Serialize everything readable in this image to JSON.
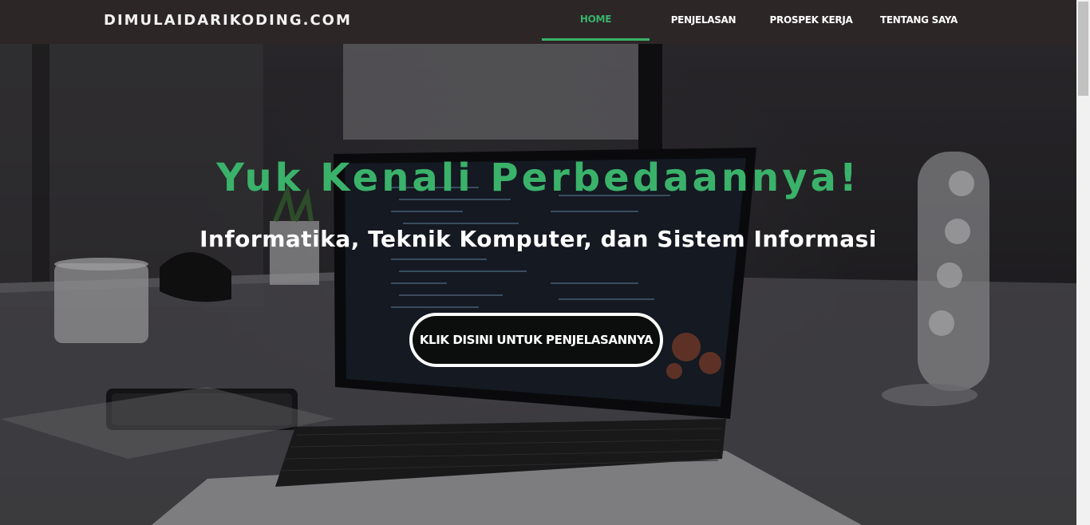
{
  "navbar": {
    "brand": "DIMULAIDARIKODING.COM",
    "items": [
      {
        "label": "HOME",
        "active": true
      },
      {
        "label": "PENJELASAN",
        "active": false
      },
      {
        "label": "PROSPEK KERJA",
        "active": false
      },
      {
        "label": "TENTANG SAYA",
        "active": false
      }
    ]
  },
  "hero": {
    "title": "Yuk Kenali Perbedaannya!",
    "subtitle": "Informatika, Teknik Komputer, dan Sistem Informasi",
    "cta_label": "KLIK DISINI UNTUK PENJELASANNYA",
    "background_image": "laptop-on-desk-photo"
  },
  "colors": {
    "accent": "#3ab26a",
    "navbar_bg": "#2c2627",
    "text_light": "#ffffff"
  }
}
